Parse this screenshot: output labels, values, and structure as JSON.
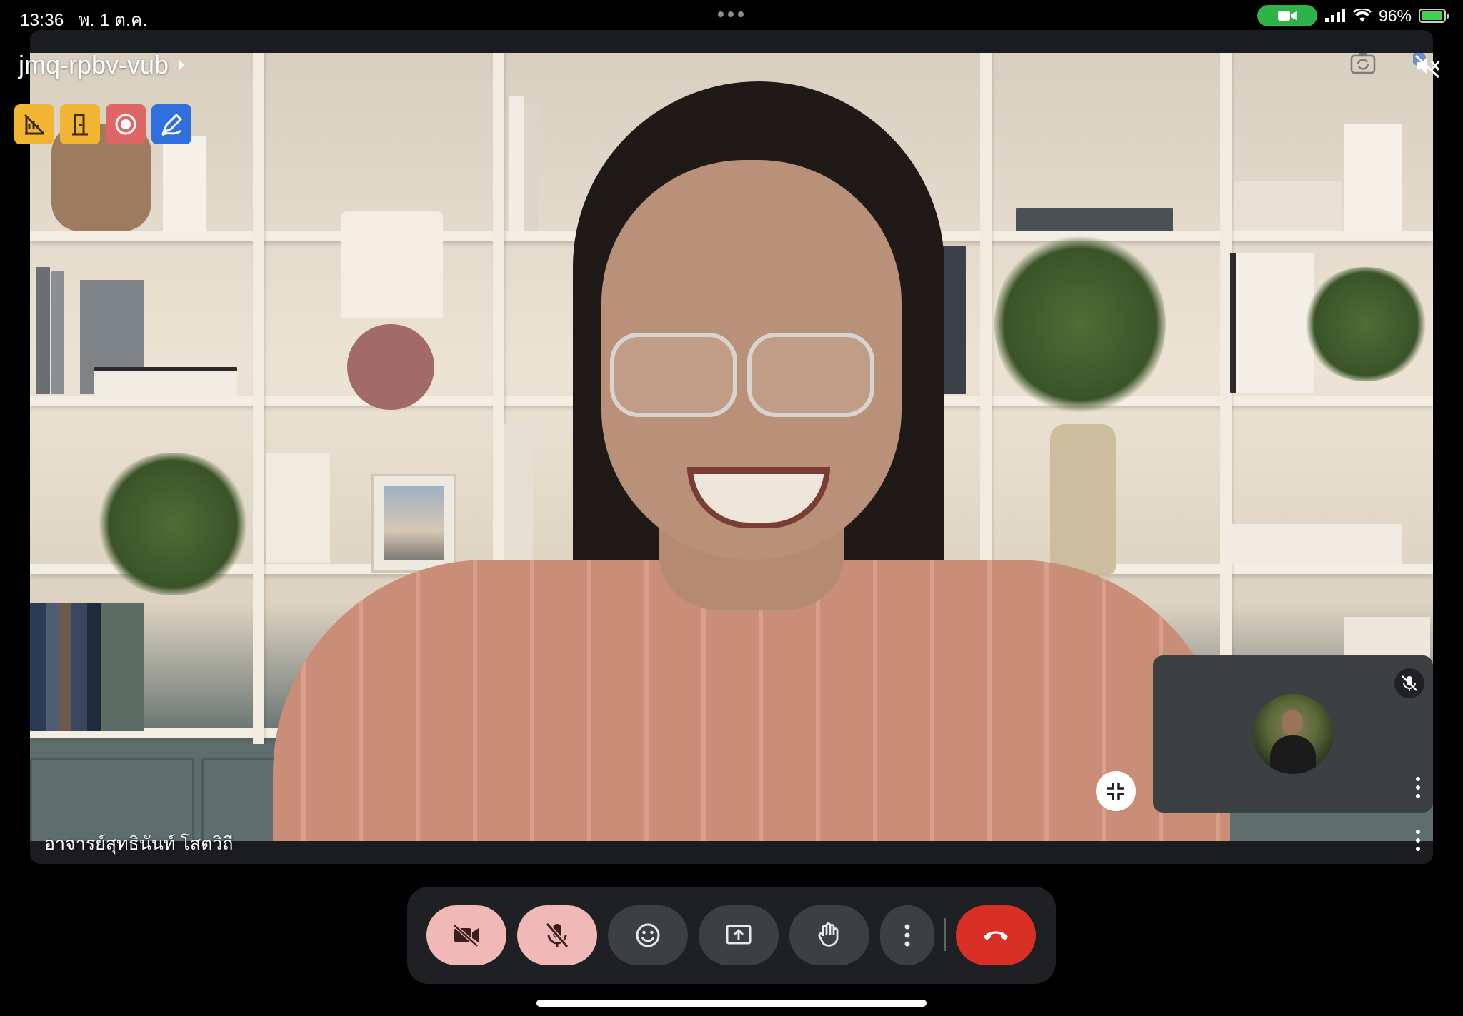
{
  "status_bar": {
    "time": "13:36",
    "date": "พ. 1 ต.ค.",
    "battery": "96%",
    "battery_level": 0.96,
    "icons": [
      "camera-in-use-icon",
      "cellular-signal-icon",
      "wifi-icon",
      "battery-charging-icon"
    ]
  },
  "meeting": {
    "code": "jmq-rpbv-vub",
    "badges": [
      {
        "name": "chart-off-icon",
        "color": "#f2b531"
      },
      {
        "name": "door-icon",
        "color": "#f2b531"
      },
      {
        "name": "record-icon",
        "color": "#e06666"
      },
      {
        "name": "whiteboard-pen-icon",
        "color": "#2f6fde"
      }
    ]
  },
  "speaker": {
    "name": "อาจารย์สุทธินันท์ โสตวิถี"
  },
  "self_view": {
    "muted": true
  },
  "controls": [
    {
      "name": "camera-off-button",
      "icon": "video-off-icon",
      "style": "pink"
    },
    {
      "name": "mic-off-button",
      "icon": "mic-off-icon",
      "style": "pink"
    },
    {
      "name": "reactions-button",
      "icon": "smiley-icon",
      "style": "dark"
    },
    {
      "name": "present-button",
      "icon": "present-screen-icon",
      "style": "dark"
    },
    {
      "name": "raise-hand-button",
      "icon": "hand-icon",
      "style": "dark"
    },
    {
      "name": "more-options-button",
      "icon": "more-vertical-icon",
      "style": "dark"
    },
    {
      "name": "leave-call-button",
      "icon": "hang-up-icon",
      "style": "red"
    }
  ],
  "colors": {
    "accent_red": "#d93025",
    "muted_pink": "#f0b8b6",
    "dark_button": "#3c4043",
    "bar_background": "#1f2023"
  }
}
